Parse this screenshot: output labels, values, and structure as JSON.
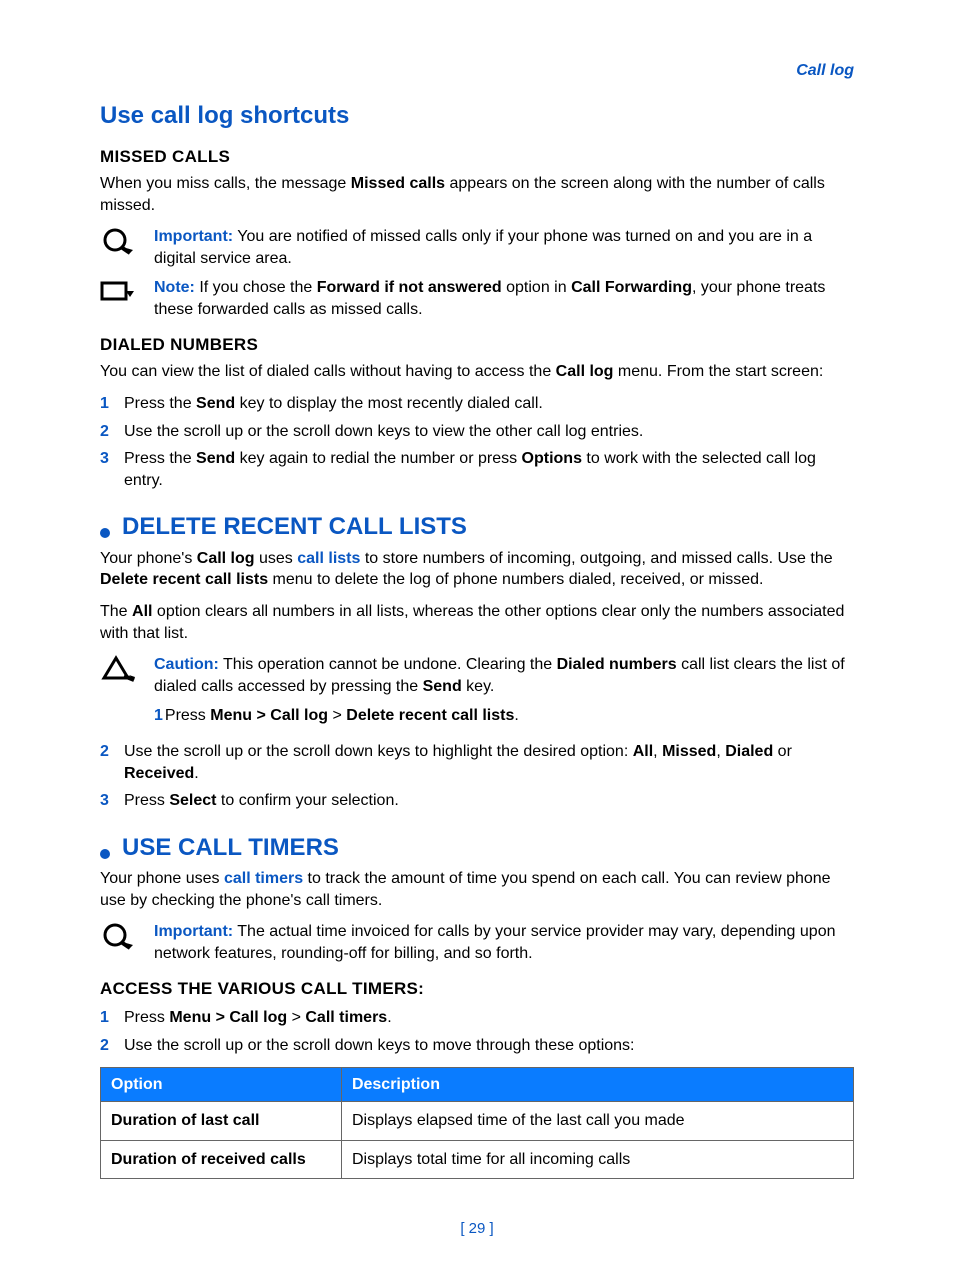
{
  "header": {
    "section_label": "Call log"
  },
  "h_shortcuts": "Use call log shortcuts",
  "missed": {
    "heading": "MISSED CALLS",
    "p1a": "When you miss calls, the message ",
    "p1b": "Missed calls",
    "p1c": " appears on the screen along with the number of calls missed.",
    "important_label": "Important:",
    "important_text": " You are notified of missed calls only if your phone was turned on and you are in a digital service area.",
    "note_label": "Note:",
    "note_a": " If you chose the ",
    "note_b": "Forward if not answered",
    "note_c": " option in ",
    "note_d": "Call Forwarding",
    "note_e": ", your phone treats these forwarded calls as missed calls."
  },
  "dialed": {
    "heading": "DIALED NUMBERS",
    "p1a": "You can view the list of dialed calls without having to access the ",
    "p1b": "Call log",
    "p1c": " menu. From the start screen:",
    "s1a": "Press the ",
    "s1b": "Send",
    "s1c": " key to display the most recently dialed call.",
    "s2": "Use the scroll up or the scroll down keys to view the other call log entries.",
    "s3a": "Press the ",
    "s3b": "Send",
    "s3c": " key again to redial the number or press ",
    "s3d": "Options",
    "s3e": " to work with the selected call log entry."
  },
  "delete": {
    "heading": "Delete recent call lists",
    "p1a": "Your phone's ",
    "p1b": "Call log",
    "p1c": " uses ",
    "p1d": "call lists",
    "p1e": " to store numbers of incoming, outgoing, and missed calls. Use the ",
    "p1f": "Delete recent call lists",
    "p1g": " menu to delete the log of phone numbers dialed, received, or missed.",
    "p2a": "The ",
    "p2b": "All",
    "p2c": " option clears all numbers in all lists, whereas the other options clear only the numbers associated with that list.",
    "caution_label": "Caution:",
    "caution_a": " This operation cannot be undone. Clearing the ",
    "caution_b": "Dialed numbers",
    "caution_c": " call list clears the list of dialed calls accessed by pressing the ",
    "caution_d": "Send",
    "caution_e": " key.",
    "s1_num": "1",
    "s1a": "Press ",
    "s1b": "Menu > Call log",
    "s1c": " > ",
    "s1d": "Delete recent call lists",
    "s1e": ".",
    "s2a": "Use the scroll up or the scroll down keys to highlight the desired option: ",
    "s2b": "All",
    "s2c": ", ",
    "s2d": "Missed",
    "s2e": ", ",
    "s2f": "Dialed",
    "s2g": " or ",
    "s2h": "Received",
    "s2i": ".",
    "s3a": "Press ",
    "s3b": "Select",
    "s3c": " to confirm your selection."
  },
  "timers": {
    "heading": "Use call timers",
    "p1a": "Your phone uses ",
    "p1b": "call timers",
    "p1c": " to track the amount of time you spend on each call. You can review phone use by checking the phone's call timers.",
    "important_label": "Important:",
    "important_text": " The actual time invoiced for calls by your service provider may vary, depending upon network features, rounding-off for billing, and so forth.",
    "sub": "ACCESS THE VARIOUS CALL TIMERS:",
    "s1a": "Press ",
    "s1b": "Menu > Call log",
    "s1c": " > ",
    "s1d": "Call timers",
    "s1e": ".",
    "s2": "Use the scroll up or the scroll down keys to move through these options:",
    "table": {
      "h1": "Option",
      "h2": "Description",
      "rows": [
        {
          "opt": "Duration of last call",
          "desc": "Displays elapsed time of the last call you made"
        },
        {
          "opt": "Duration of received calls",
          "desc": "Displays total time for all incoming calls"
        }
      ]
    }
  },
  "nums": {
    "n1": "1",
    "n2": "2",
    "n3": "3"
  },
  "page_number": "[ 29 ]"
}
